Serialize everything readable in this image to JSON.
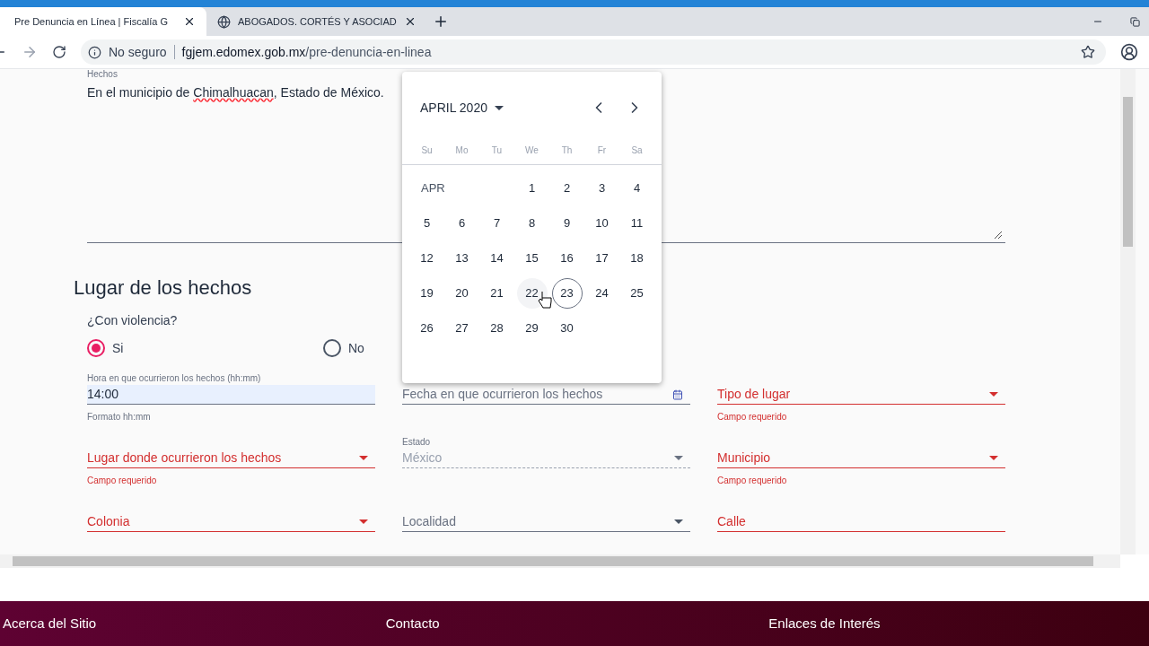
{
  "browser": {
    "tabs": [
      {
        "title": "Pre Denuncia en Línea | Fiscalía G",
        "selected": true
      },
      {
        "title": "ABOGADOS. CORTÉS Y ASOCIAD",
        "selected": false
      }
    ],
    "security": "No seguro",
    "url_host": "fgjem.edomex.gob.mx",
    "url_path": "/pre-denuncia-en-linea"
  },
  "hechos": {
    "label": "Hechos",
    "text_before": "En el municipio de ",
    "misspelled": "Chimalhuacan",
    "text_after": ", Estado de México."
  },
  "section_title": "Lugar de los hechos",
  "violencia": {
    "label": "¿Con violencia?",
    "options": [
      {
        "label": "Si",
        "selected": true
      },
      {
        "label": "No",
        "selected": false
      }
    ]
  },
  "fields": [
    {
      "kind": "text",
      "label": "Hora en que ocurrieron los hechos (hh:mm)",
      "value": "14:00",
      "hint": "Formato hh:mm",
      "error": false,
      "disabled": false
    },
    {
      "kind": "date",
      "placeholder": "Fecha en que ocurrieron los hechos",
      "error": false,
      "disabled": false
    },
    {
      "kind": "select",
      "placeholder": "Tipo de lugar",
      "hint": "Campo requerido",
      "error": true,
      "disabled": false
    },
    {
      "kind": "select",
      "placeholder": "Lugar donde ocurrieron los hechos",
      "hint": "Campo requerido",
      "error": true,
      "disabled": false
    },
    {
      "kind": "select",
      "label": "Estado",
      "value": "México",
      "error": false,
      "disabled": true
    },
    {
      "kind": "select",
      "placeholder": "Municipio",
      "hint": "Campo requerido",
      "error": true,
      "disabled": false
    },
    {
      "kind": "select",
      "placeholder": "Colonia",
      "error": true,
      "disabled": false
    },
    {
      "kind": "select",
      "placeholder": "Localidad",
      "error": false,
      "disabled": false
    },
    {
      "kind": "text",
      "placeholder": "Calle",
      "error": true,
      "disabled": false
    }
  ],
  "calendar": {
    "title": "APRIL 2020",
    "weekdays": [
      "Su",
      "Mo",
      "Tu",
      "We",
      "Th",
      "Fr",
      "Sa"
    ],
    "month_label": "APR",
    "weeks": [
      [
        {
          "label": "1",
          "today": false,
          "hovered": false
        },
        {
          "label": "2",
          "today": false,
          "hovered": false
        },
        {
          "label": "3",
          "today": false,
          "hovered": false
        },
        {
          "label": "4",
          "today": false,
          "hovered": false
        }
      ],
      [
        {
          "label": "5",
          "today": false,
          "hovered": false
        },
        {
          "label": "6",
          "today": false,
          "hovered": false
        },
        {
          "label": "7",
          "today": false,
          "hovered": false
        },
        {
          "label": "8",
          "today": false,
          "hovered": false
        },
        {
          "label": "9",
          "today": false,
          "hovered": false
        },
        {
          "label": "10",
          "today": false,
          "hovered": false
        },
        {
          "label": "11",
          "today": false,
          "hovered": false
        }
      ],
      [
        {
          "label": "12",
          "today": false,
          "hovered": false
        },
        {
          "label": "13",
          "today": false,
          "hovered": false
        },
        {
          "label": "14",
          "today": false,
          "hovered": false
        },
        {
          "label": "15",
          "today": false,
          "hovered": false
        },
        {
          "label": "16",
          "today": false,
          "hovered": false
        },
        {
          "label": "17",
          "today": false,
          "hovered": false
        },
        {
          "label": "18",
          "today": false,
          "hovered": false
        }
      ],
      [
        {
          "label": "19",
          "today": false,
          "hovered": false
        },
        {
          "label": "20",
          "today": false,
          "hovered": false
        },
        {
          "label": "21",
          "today": false,
          "hovered": false
        },
        {
          "label": "22",
          "today": false,
          "hovered": true
        },
        {
          "label": "23",
          "today": true,
          "hovered": false
        },
        {
          "label": "24",
          "today": false,
          "hovered": false
        },
        {
          "label": "25",
          "today": false,
          "hovered": false
        }
      ],
      [
        {
          "label": "26",
          "today": false,
          "hovered": false
        },
        {
          "label": "27",
          "today": false,
          "hovered": false
        },
        {
          "label": "28",
          "today": false,
          "hovered": false
        },
        {
          "label": "29",
          "today": false,
          "hovered": false
        },
        {
          "label": "30",
          "today": false,
          "hovered": false
        }
      ]
    ]
  },
  "footer": [
    "Acerca del Sitio",
    "Contacto",
    "Enlaces de Interés"
  ]
}
